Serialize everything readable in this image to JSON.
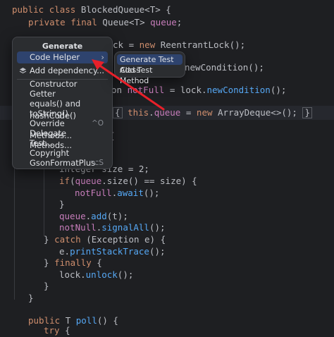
{
  "code": {
    "l1": {
      "kw1": "public",
      "kw2": "class",
      "name": "BlockedQueue<T>",
      "brace": "{"
    },
    "l2": {
      "kw1": "private",
      "kw2": "final",
      "rest": "Queue<T>",
      "fld": "queue",
      "end": ";"
    },
    "l3": {
      "pre": "ck = ",
      "kw": "new",
      "rest": "ReentrantLock();"
    },
    "l4": {
      "rest": "newCondition();"
    },
    "l5": {
      "pre": "on",
      "fld": "notFull",
      "mid": "= lock.",
      "mth": "newCondition",
      "end": "();"
    },
    "l6": {
      "open": "{",
      "kw": "this",
      "dot": ".",
      "fld": "queue",
      "mid": " = ",
      "kw2": "new",
      "rest": "ArrayDeque<>();",
      "close": "}"
    },
    "l7": {
      "text": "{"
    },
    "l8": {
      "text": "integer size = 2;"
    },
    "l9": {
      "kw": "if",
      "open": "(",
      "fld": "queue",
      "mid": ".size() == size) {"
    },
    "l10": {
      "fld": "notFull",
      "dot": ".",
      "mth": "await",
      "end": "();"
    },
    "l11": {
      "text": "}"
    },
    "l12": {
      "fld": "queue",
      "dot": ".",
      "mth": "add",
      "end": "(t);"
    },
    "l13": {
      "fld": "notNull",
      "dot": ".",
      "mth": "signalAll",
      "end": "();"
    },
    "l14": {
      "close": "}",
      "kw": "catch",
      "rest": "(Exception e) {"
    },
    "l15": {
      "pre": "e.",
      "mth": "printStackTrace",
      "end": "();"
    },
    "l16": {
      "close": "}",
      "kw": "finally",
      "rest": "{"
    },
    "l17": {
      "pre": "lock.",
      "mth": "unlock",
      "end": "();"
    },
    "l18": {
      "text": "}"
    },
    "l19": {
      "text": "}"
    },
    "l20": {
      "kw": "public",
      "rest": "T",
      "mth": "poll",
      "end": "() {"
    },
    "l21": {
      "kw": "try",
      "rest": "{"
    }
  },
  "menu": {
    "title": "Generate",
    "items": [
      {
        "label": "Code Helper",
        "chevron": "›"
      },
      {
        "label": "Add dependency..."
      },
      {
        "label": "Constructor"
      },
      {
        "label": "Getter"
      },
      {
        "label": "equals() and hashCode()"
      },
      {
        "label": "toString()"
      },
      {
        "label": "Override Methods...",
        "shortcut": "^O"
      },
      {
        "label": "Delegate Methods..."
      },
      {
        "label": "Test..."
      },
      {
        "label": "Copyright"
      },
      {
        "label": "GsonFormatPlus",
        "shortcut": "⌥S"
      }
    ]
  },
  "submenu": {
    "items": [
      {
        "label": "Generate Test Class"
      },
      {
        "label": "Add Test Method"
      }
    ]
  },
  "colors": {
    "accent_selection": "#2e436e",
    "arrow": "#e8202a"
  }
}
